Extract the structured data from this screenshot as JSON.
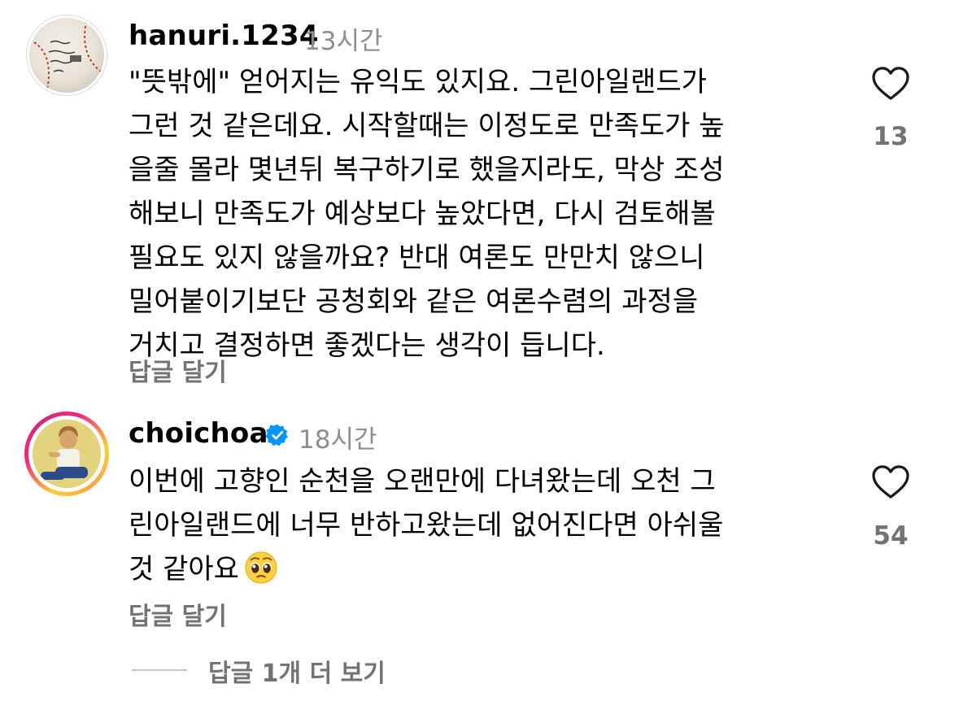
{
  "comments": [
    {
      "username": "hanuri.1234",
      "time": "13시간",
      "lines": [
        "\"뜻밖에\" 얻어지는 유익도 있지요. 그린아일랜드가",
        "그런 것 같은데요. 시작할때는 이정도로 만족도가 높",
        "을줄 몰라 몇년뒤 복구하기로 했을지라도, 막상 조성",
        "해보니 만족도가 예상보다 높았다면, 다시 검토해볼",
        "필요도 있지 않을까요? 반대 여론도 만만치 않으니",
        "밀어붙이기보단 공청회와 같은 여론수렴의 과정을",
        "거치고 결정하면 좋겠다는 생각이 듭니다."
      ],
      "reply_label": "답글 달기",
      "like_count": "13",
      "icon": "heart-outline-icon",
      "avatar": "baseball-photo"
    },
    {
      "username": "choichoa",
      "verified": true,
      "time": "18시간",
      "lines": [
        "이번에 고향인 순천을 오랜만에 다녀왔는데 오천 그",
        "린아일랜드에 너무 반하고왔는데 없어진다면 아쉬울",
        "것 같아요"
      ],
      "emoji": "pleading-face",
      "reply_label": "답글 달기",
      "like_count": "54",
      "icon": "heart-outline-icon",
      "avatar": "person-photo"
    }
  ],
  "view_more_replies": "답글 1개 더 보기",
  "colors": {
    "verified_blue": "#0095f6",
    "secondary_text": "#737373",
    "time_text": "#8e8e8e"
  }
}
